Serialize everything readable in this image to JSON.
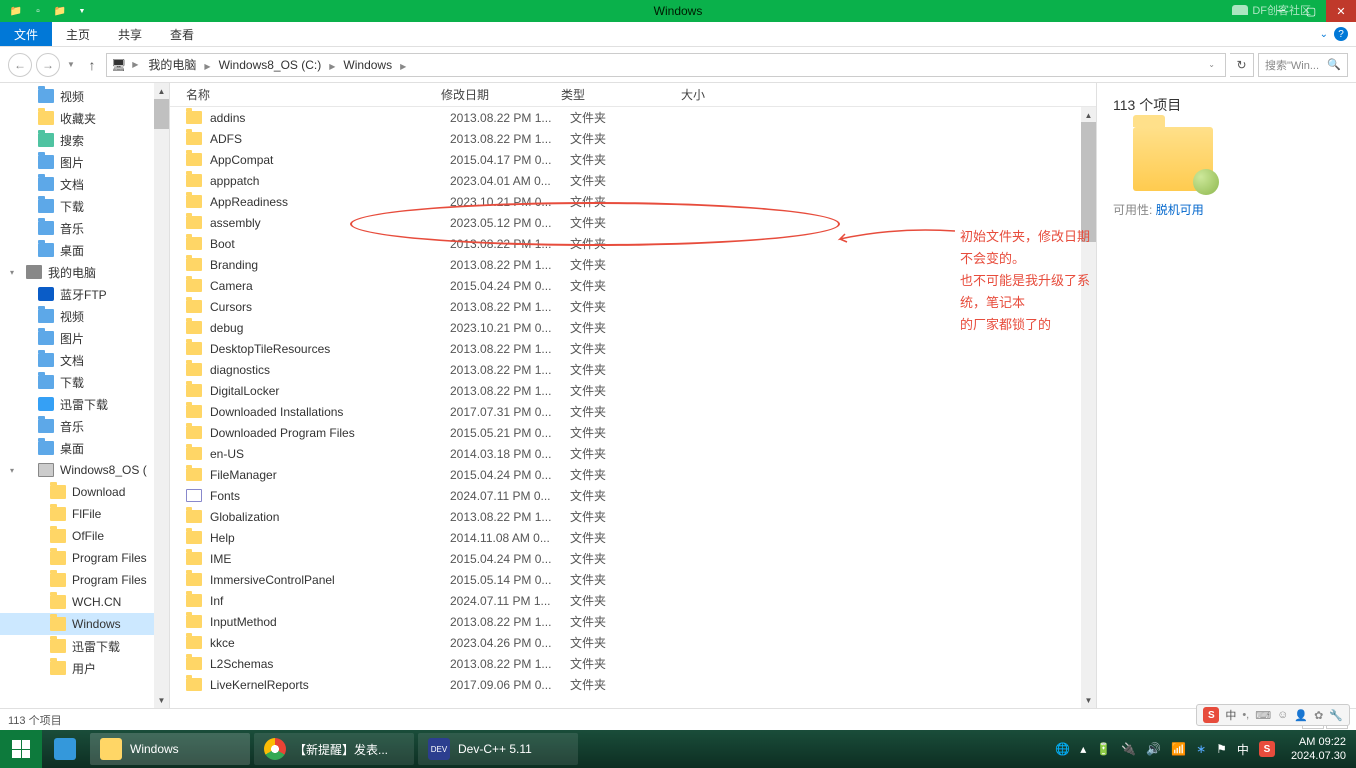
{
  "window": {
    "title": "Windows",
    "watermark": "DF创客社区"
  },
  "ribbon": {
    "file": "文件",
    "tabs": [
      "主页",
      "共享",
      "查看"
    ]
  },
  "address": {
    "parts": [
      "我的电脑",
      "Windows8_OS (C:)",
      "Windows"
    ],
    "search_placeholder": "搜索\"Win..."
  },
  "sidebar": [
    {
      "label": "视频",
      "icon": "blue",
      "lvl": 2
    },
    {
      "label": "收藏夹",
      "icon": "fold",
      "lvl": 2
    },
    {
      "label": "搜索",
      "icon": "teal",
      "lvl": 2
    },
    {
      "label": "图片",
      "icon": "blue",
      "lvl": 2
    },
    {
      "label": "文档",
      "icon": "blue",
      "lvl": 2
    },
    {
      "label": "下载",
      "icon": "blue",
      "lvl": 2
    },
    {
      "label": "音乐",
      "icon": "blue",
      "lvl": 2
    },
    {
      "label": "桌面",
      "icon": "blue",
      "lvl": 2
    },
    {
      "label": "我的电脑",
      "icon": "pc",
      "lvl": 1,
      "exp": true
    },
    {
      "label": "蓝牙FTP",
      "icon": "bt",
      "lvl": 2
    },
    {
      "label": "视频",
      "icon": "blue",
      "lvl": 2
    },
    {
      "label": "图片",
      "icon": "blue",
      "lvl": 2
    },
    {
      "label": "文档",
      "icon": "blue",
      "lvl": 2
    },
    {
      "label": "下载",
      "icon": "blue",
      "lvl": 2
    },
    {
      "label": "迅雷下载",
      "icon": "xl",
      "lvl": 2
    },
    {
      "label": "音乐",
      "icon": "blue",
      "lvl": 2
    },
    {
      "label": "桌面",
      "icon": "blue",
      "lvl": 2
    },
    {
      "label": "Windows8_OS (",
      "icon": "drive",
      "lvl": 2,
      "exp": true
    },
    {
      "label": "Download",
      "icon": "fold",
      "lvl": 3
    },
    {
      "label": "FlFile",
      "icon": "fold",
      "lvl": 3
    },
    {
      "label": "OfFile",
      "icon": "fold",
      "lvl": 3
    },
    {
      "label": "Program Files",
      "icon": "fold",
      "lvl": 3
    },
    {
      "label": "Program Files",
      "icon": "fold",
      "lvl": 3
    },
    {
      "label": "WCH.CN",
      "icon": "fold",
      "lvl": 3
    },
    {
      "label": "Windows",
      "icon": "fold",
      "lvl": 3,
      "sel": true
    },
    {
      "label": "迅雷下载",
      "icon": "fold",
      "lvl": 3
    },
    {
      "label": "用户",
      "icon": "fold",
      "lvl": 3
    }
  ],
  "columns": {
    "name": "名称",
    "date": "修改日期",
    "type": "类型",
    "size": "大小"
  },
  "files": [
    {
      "name": "addins",
      "date": "2013.08.22 PM 1...",
      "type": "文件夹"
    },
    {
      "name": "ADFS",
      "date": "2013.08.22 PM 1...",
      "type": "文件夹"
    },
    {
      "name": "AppCompat",
      "date": "2015.04.17 PM 0...",
      "type": "文件夹"
    },
    {
      "name": "apppatch",
      "date": "2023.04.01 AM 0...",
      "type": "文件夹"
    },
    {
      "name": "AppReadiness",
      "date": "2023.10.21 PM 0...",
      "type": "文件夹"
    },
    {
      "name": "assembly",
      "date": "2023.05.12 PM 0...",
      "type": "文件夹"
    },
    {
      "name": "Boot",
      "date": "2013.08.22 PM 1...",
      "type": "文件夹"
    },
    {
      "name": "Branding",
      "date": "2013.08.22 PM 1...",
      "type": "文件夹"
    },
    {
      "name": "Camera",
      "date": "2015.04.24 PM 0...",
      "type": "文件夹"
    },
    {
      "name": "Cursors",
      "date": "2013.08.22 PM 1...",
      "type": "文件夹"
    },
    {
      "name": "debug",
      "date": "2023.10.21 PM 0...",
      "type": "文件夹"
    },
    {
      "name": "DesktopTileResources",
      "date": "2013.08.22 PM 1...",
      "type": "文件夹"
    },
    {
      "name": "diagnostics",
      "date": "2013.08.22 PM 1...",
      "type": "文件夹"
    },
    {
      "name": "DigitalLocker",
      "date": "2013.08.22 PM 1...",
      "type": "文件夹"
    },
    {
      "name": "Downloaded Installations",
      "date": "2017.07.31 PM 0...",
      "type": "文件夹"
    },
    {
      "name": "Downloaded Program Files",
      "date": "2015.05.21 PM 0...",
      "type": "文件夹"
    },
    {
      "name": "en-US",
      "date": "2014.03.18 PM 0...",
      "type": "文件夹"
    },
    {
      "name": "FileManager",
      "date": "2015.04.24 PM 0...",
      "type": "文件夹"
    },
    {
      "name": "Fonts",
      "date": "2024.07.11 PM 0...",
      "type": "文件夹",
      "font": true
    },
    {
      "name": "Globalization",
      "date": "2013.08.22 PM 1...",
      "type": "文件夹"
    },
    {
      "name": "Help",
      "date": "2014.11.08 AM 0...",
      "type": "文件夹"
    },
    {
      "name": "IME",
      "date": "2015.04.24 PM 0...",
      "type": "文件夹"
    },
    {
      "name": "ImmersiveControlPanel",
      "date": "2015.05.14 PM 0...",
      "type": "文件夹"
    },
    {
      "name": "Inf",
      "date": "2024.07.11 PM 1...",
      "type": "文件夹"
    },
    {
      "name": "InputMethod",
      "date": "2013.08.22 PM 1...",
      "type": "文件夹"
    },
    {
      "name": "kkce",
      "date": "2023.04.26 PM 0...",
      "type": "文件夹"
    },
    {
      "name": "L2Schemas",
      "date": "2013.08.22 PM 1...",
      "type": "文件夹"
    },
    {
      "name": "LiveKernelReports",
      "date": "2017.09.06 PM 0...",
      "type": "文件夹"
    }
  ],
  "details": {
    "count": "113 个项目",
    "avail_label": "可用性:",
    "avail_value": "脱机可用"
  },
  "statusbar": {
    "text": "113 个项目"
  },
  "annotation": "初始文件夹，修改日期不会变的。\n也不可能是我升级了系统，笔记本\n的厂家都锁了的",
  "taskbar": {
    "items": [
      {
        "label": "Windows",
        "icon": "fold",
        "cls": "active"
      },
      {
        "label": "【新提醒】发表...",
        "icon": "chrome",
        "cls": "app"
      },
      {
        "label": "Dev-C++ 5.11",
        "icon": "dev",
        "cls": "app"
      }
    ],
    "clock": {
      "time": "AM 09:22",
      "date": "2024.07.30"
    }
  },
  "ime": {
    "lang": "中",
    "punct": "•,",
    "full": "⊙"
  }
}
